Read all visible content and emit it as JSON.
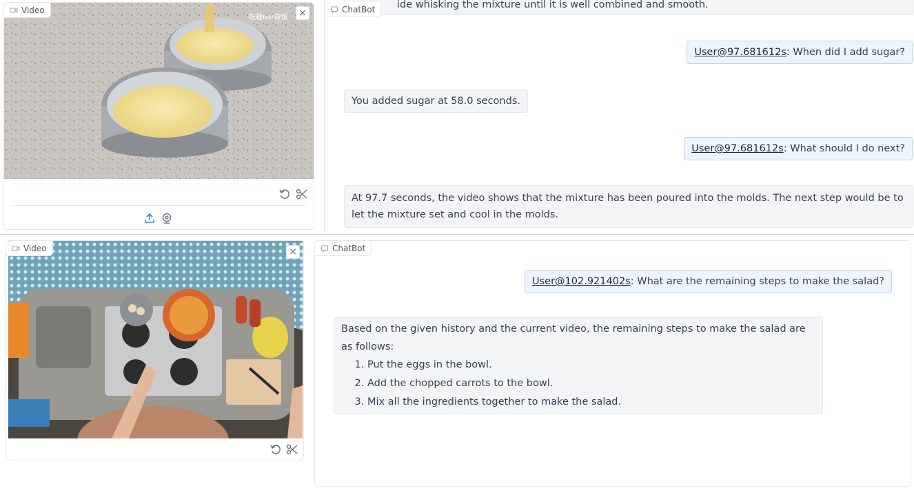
{
  "top": {
    "video": {
      "label": "Video",
      "watermark": "吃糖bar做饭",
      "close": "×"
    },
    "chat": {
      "label": "ChatBot",
      "partial_text": "ide whisking the mixture until it is well combined and smooth.",
      "messages": [
        {
          "role": "user",
          "timestamp": "User@97.681612s",
          "text": ": When did I add sugar?"
        },
        {
          "role": "bot",
          "text": "You added sugar at 58.0 seconds."
        },
        {
          "role": "user",
          "timestamp": "User@97.681612s",
          "text": ": What should I do next?"
        },
        {
          "role": "bot",
          "text": "At 97.7 seconds, the video shows that the mixture has been poured into the molds. The next step would be to let the mixture set and cool in the molds."
        }
      ]
    }
  },
  "bottom": {
    "video": {
      "label": "Video",
      "close": "×"
    },
    "chat": {
      "label": "ChatBot",
      "messages": [
        {
          "role": "user",
          "timestamp": "User@102.921402s",
          "text": ": What are the remaining steps to make the salad?"
        },
        {
          "role": "bot",
          "intro": "Based on the given history and the current video, the remaining steps to make the salad are as follows:",
          "steps": [
            "Put the eggs in the bowl.",
            "Add the chopped carrots to the bowl.",
            "Mix all the ingredients together to make the salad."
          ]
        }
      ]
    }
  },
  "icons": [
    "video-icon",
    "chatbot-icon",
    "close-icon",
    "undo-icon",
    "scissors-icon",
    "upload-icon",
    "webcam-icon"
  ],
  "colors": {
    "user_bubble": "#eef4fc",
    "user_border": "#bcd4ee",
    "bot_bubble": "#f3f4f6",
    "border": "#e5e7eb"
  }
}
